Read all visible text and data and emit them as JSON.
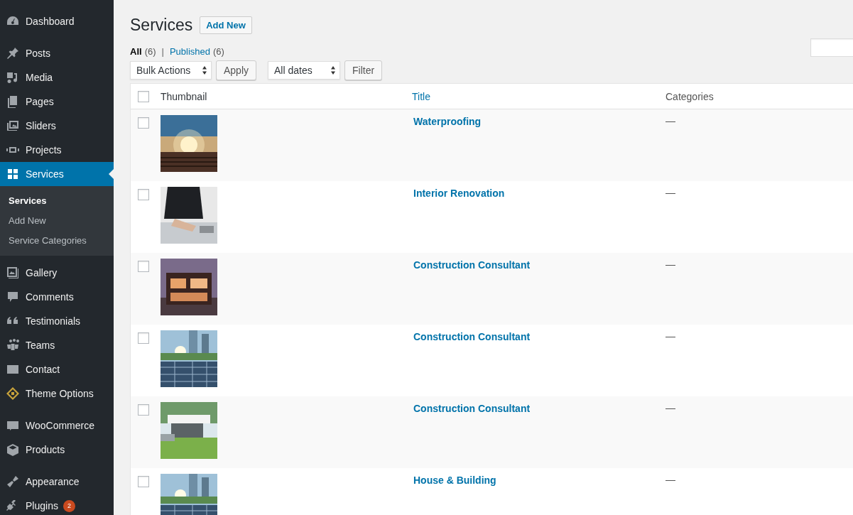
{
  "sidebar": {
    "groups": [
      [
        {
          "label": "Dashboard",
          "selected": false
        }
      ],
      [
        {
          "label": "Posts",
          "selected": false
        },
        {
          "label": "Media",
          "selected": false
        },
        {
          "label": "Pages",
          "selected": false
        },
        {
          "label": "Sliders",
          "selected": false
        },
        {
          "label": "Projects",
          "selected": false
        },
        {
          "label": "Services",
          "selected": true,
          "children": [
            {
              "label": "Services",
              "selected": true
            },
            {
              "label": "Add New",
              "selected": false
            },
            {
              "label": "Service Categories",
              "selected": false
            }
          ]
        },
        {
          "label": "Gallery",
          "selected": false
        },
        {
          "label": "Comments",
          "selected": false
        },
        {
          "label": "Testimonials",
          "selected": false
        },
        {
          "label": "Teams",
          "selected": false
        },
        {
          "label": "Contact",
          "selected": false
        },
        {
          "label": "Theme Options",
          "selected": false
        }
      ],
      [
        {
          "label": "WooCommerce",
          "selected": false
        },
        {
          "label": "Products",
          "selected": false
        }
      ],
      [
        {
          "label": "Appearance",
          "selected": false
        },
        {
          "label": "Plugins",
          "selected": false,
          "badge": "2"
        }
      ]
    ]
  },
  "page": {
    "title": "Services",
    "add_new": "Add New"
  },
  "filters": [
    {
      "label": "All",
      "count": "(6)",
      "selected": true
    },
    {
      "label": "Published",
      "count": "(6)",
      "selected": false
    }
  ],
  "separator": "|",
  "toolbar": {
    "bulk_actions": "Bulk Actions",
    "apply": "Apply",
    "dates": "All dates",
    "filter": "Filter"
  },
  "table": {
    "columns": [
      {
        "label": "Thumbnail",
        "sortable": false
      },
      {
        "label": "Title",
        "sortable": true
      },
      {
        "label": "Categories",
        "sortable": false
      }
    ],
    "header_checked": false,
    "rows": [
      {
        "title": "Waterproofing",
        "categories": "—",
        "checked": false
      },
      {
        "title": "Interior Renovation",
        "categories": "—",
        "checked": false
      },
      {
        "title": "Construction Consultant",
        "categories": "—",
        "checked": false
      },
      {
        "title": "Construction Consultant",
        "categories": "—",
        "checked": false
      },
      {
        "title": "Construction Consultant",
        "categories": "—",
        "checked": false
      },
      {
        "title": "House & Building",
        "categories": "—",
        "checked": false
      }
    ]
  }
}
